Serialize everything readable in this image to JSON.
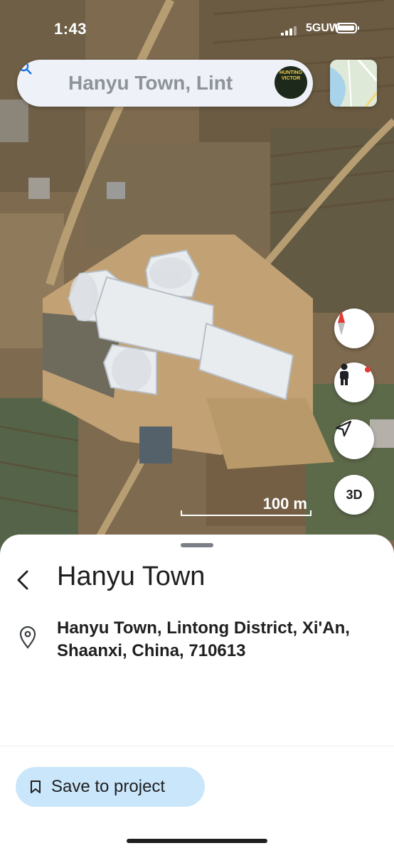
{
  "status_bar": {
    "time": "1:43",
    "network": "5GUW"
  },
  "search": {
    "query": "Hanyu Town, Lint",
    "search_icon": "search-icon"
  },
  "avatar": {
    "text": "HUNTING VICTOR",
    "icon": "avatar"
  },
  "map_controls": {
    "compass_icon": "compass-icon",
    "street_view_icon": "pegman-icon",
    "location_icon": "navigation-arrow-icon",
    "three_d_label": "3D"
  },
  "scale": {
    "label": "100 m"
  },
  "place": {
    "title": "Hanyu Town",
    "address": "Hanyu Town, Lintong District, Xi'An, Shaanxi, China, 710613"
  },
  "actions": {
    "save_label": "Save to project"
  },
  "colors": {
    "accent": "#1a73e8",
    "save_bg": "#c9e6fb",
    "compass_red": "#e53935"
  }
}
